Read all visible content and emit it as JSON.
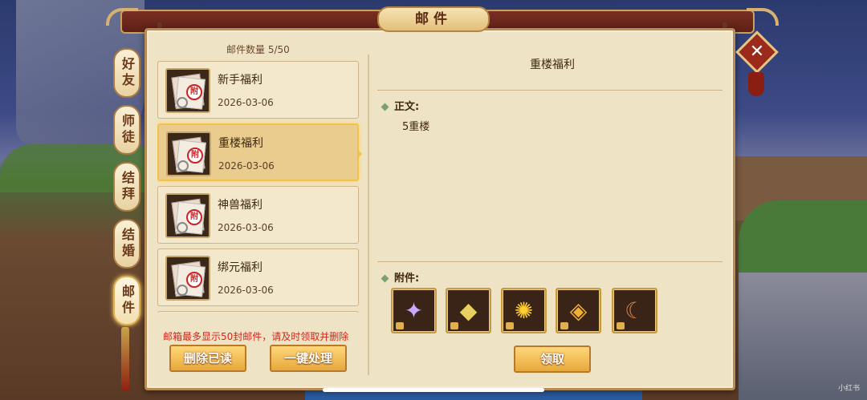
{
  "window": {
    "title": "邮件"
  },
  "side_tabs": [
    "好友",
    "师徒",
    "结拜",
    "结婚",
    "邮件"
  ],
  "close_label": "✕",
  "mailbox": {
    "count_text": "邮件数量 5/50",
    "mails": [
      {
        "title": "新手福利",
        "date": "2026-03-06"
      },
      {
        "title": "重楼福利",
        "date": "2026-03-06"
      },
      {
        "title": "神兽福利",
        "date": "2026-03-06"
      },
      {
        "title": "绑元福利",
        "date": "2026-03-06"
      }
    ],
    "seal_char": "附",
    "warning": "邮箱最多显示50封邮件，请及时领取并删除",
    "delete_read_label": "删除已读",
    "one_click_label": "一键处理"
  },
  "detail": {
    "title": "重楼福利",
    "body_label": "正文:",
    "body_text": "5重楼",
    "attachments_label": "附件:",
    "attachments": [
      {
        "icon": "star-shuriken-icon",
        "glyph": "✦",
        "color": "#c9a8ff"
      },
      {
        "icon": "golden-leaf-icon",
        "glyph": "◆",
        "color": "#e8d060"
      },
      {
        "icon": "golden-gear-orb-icon",
        "glyph": "✺",
        "color": "#ffcc33"
      },
      {
        "icon": "golden-book-icon",
        "glyph": "◈",
        "color": "#f0b030"
      },
      {
        "icon": "horn-icon",
        "glyph": "☾",
        "color": "#d88040"
      }
    ],
    "claim_label": "领取"
  },
  "watermark": "小红书"
}
